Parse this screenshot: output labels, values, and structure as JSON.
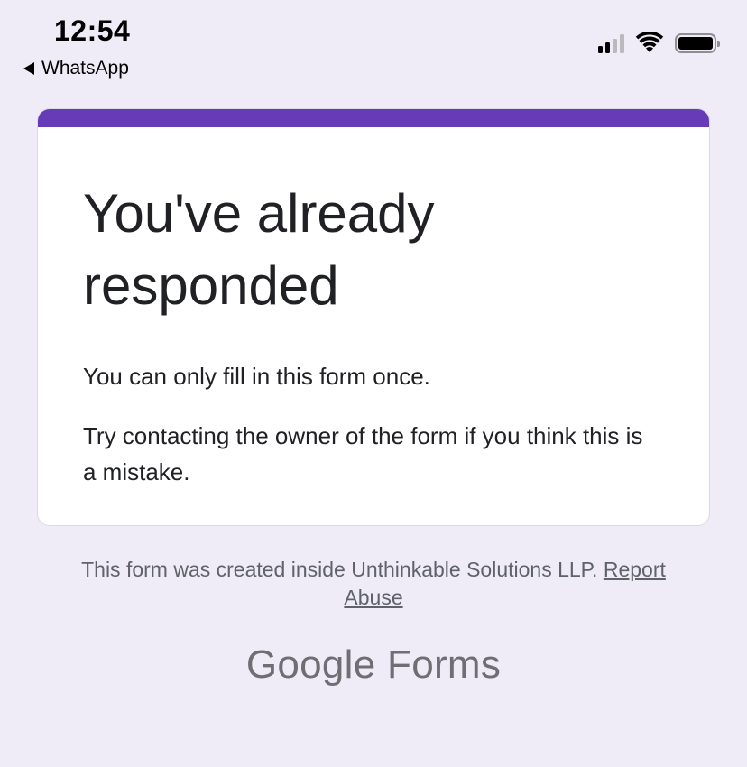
{
  "status_bar": {
    "time": "12:54",
    "back_app": "WhatsApp",
    "icons": [
      "back-triangle-icon",
      "signal-icon",
      "wifi-icon",
      "battery-icon"
    ]
  },
  "card": {
    "accent_color": "#673ab7",
    "title": "You've already responded",
    "message": "You can only fill in this form once.",
    "help_text": "Try contacting the owner of the form if you think this is a mistake."
  },
  "footer": {
    "note": "This form was created inside Unthinkable Solutions LLP.",
    "report_word1": "Report",
    "report_word2": "Abuse",
    "brand_google": "Google",
    "brand_forms": "Forms"
  }
}
